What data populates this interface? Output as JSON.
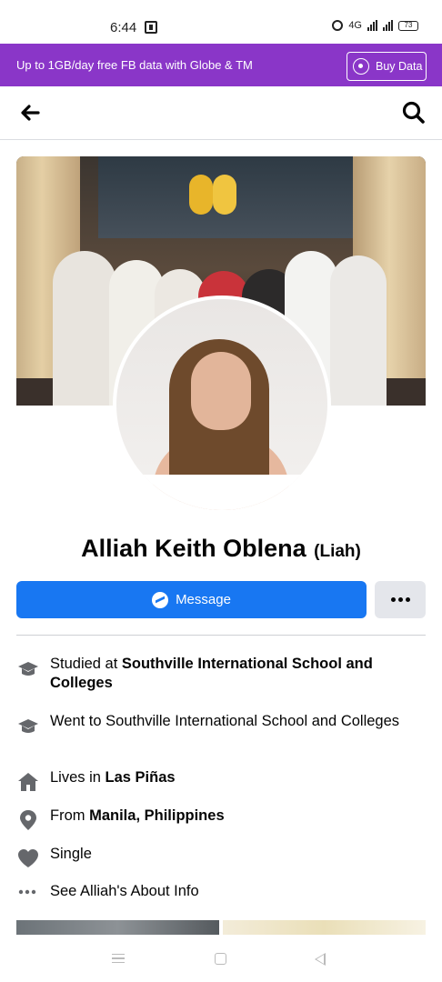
{
  "status_bar": {
    "time": "6:44",
    "network": "4G",
    "battery": "73"
  },
  "promo": {
    "text": "Up to 1GB/day free FB data with Globe & TM",
    "button_label": "Buy Data"
  },
  "header": {
    "back_icon": "arrow-left-icon",
    "search_icon": "search-icon"
  },
  "profile": {
    "name": "Alliah Keith Oblena",
    "nickname": "(Liah)"
  },
  "actions": {
    "message_label": "Message",
    "more_icon": "more-horizontal-icon"
  },
  "details": [
    {
      "icon": "graduation-cap-icon",
      "prefix": "Studied at ",
      "bold": "Southville International School and Colleges"
    },
    {
      "icon": "graduation-cap-icon",
      "prefix": "Went to Southville International School and Colleges",
      "bold": ""
    },
    {
      "icon": "home-icon",
      "prefix": "Lives in ",
      "bold": "Las Piñas"
    },
    {
      "icon": "location-pin-icon",
      "prefix": "From ",
      "bold": "Manila, Philippines"
    },
    {
      "icon": "heart-icon",
      "prefix": "Single",
      "bold": ""
    },
    {
      "icon": "ellipsis-icon",
      "prefix": "See Alliah's About Info",
      "bold": ""
    }
  ],
  "colors": {
    "promo_bg": "#8a36c8",
    "primary_blue": "#1877f2",
    "secondary_gray": "#e4e6eb"
  }
}
